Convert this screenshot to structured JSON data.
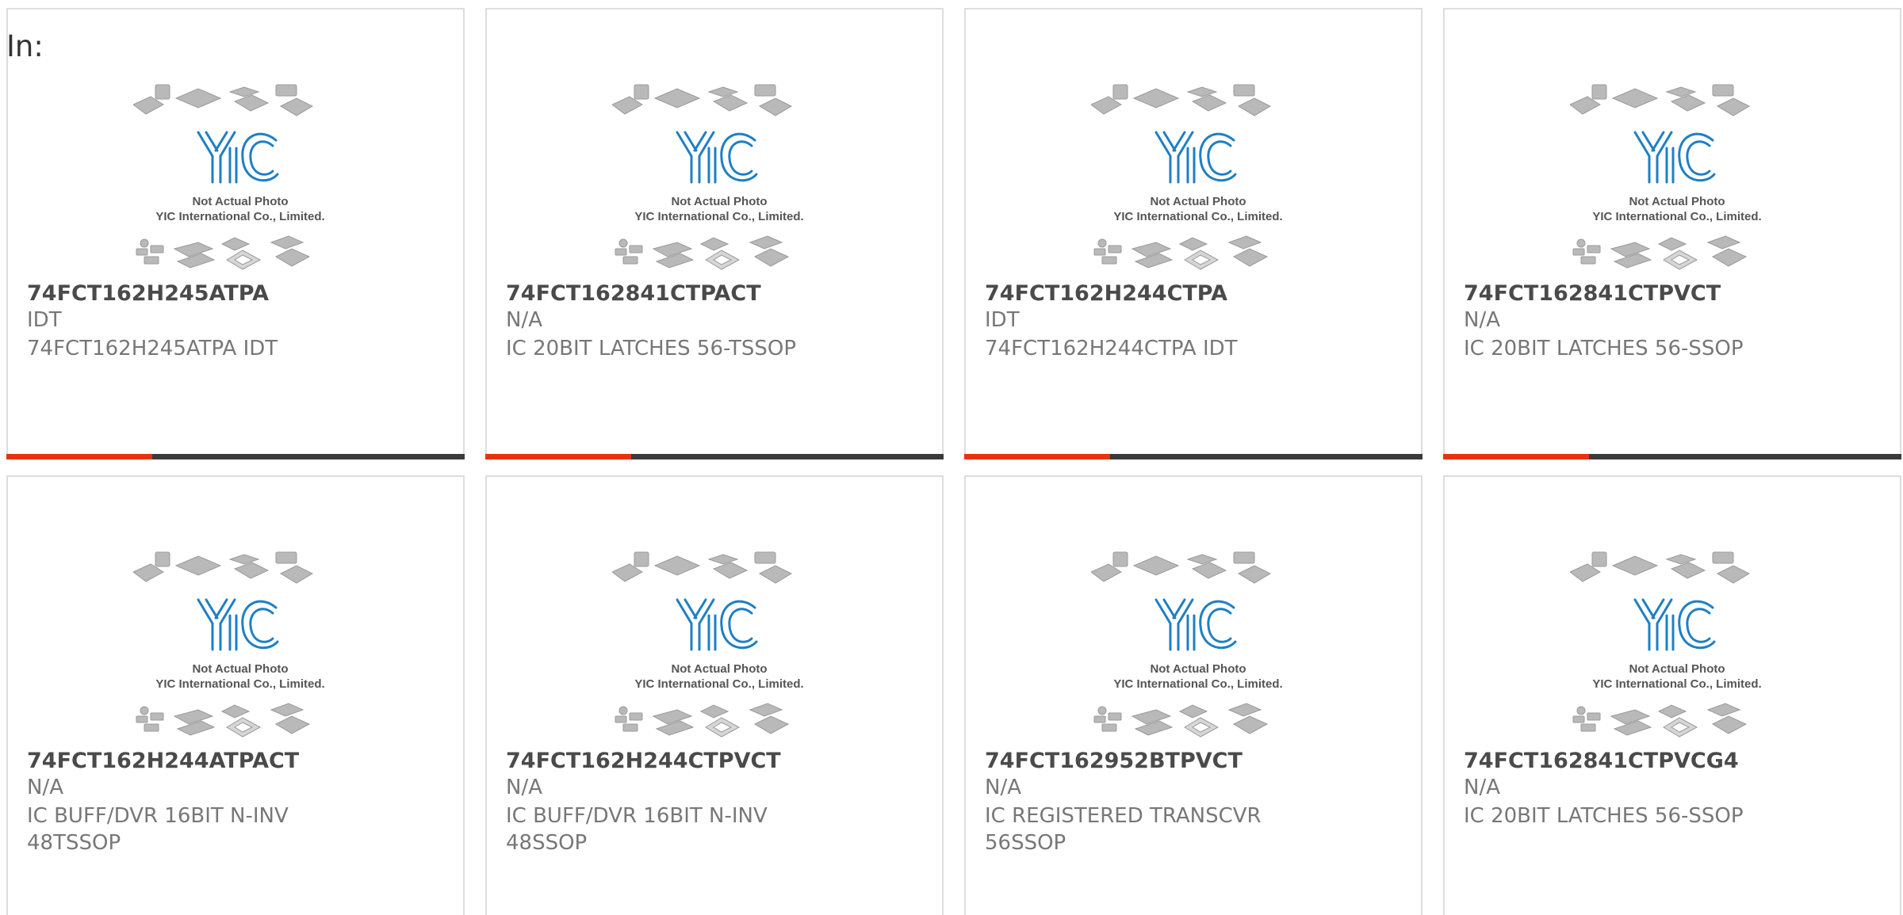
{
  "heading": "In:",
  "photo": {
    "brand": "YIC",
    "caption_line1": "Not Actual Photo",
    "caption_line2": "YIC International Co., Limited."
  },
  "colors": {
    "accent": "#e8330f",
    "bar": "#3a3a3a",
    "brand_blue": "#1e7fc4",
    "text": "#777777",
    "title": "#4a4a4a"
  },
  "products": [
    {
      "part": "74FCT162H245ATPA",
      "mfr": "IDT",
      "desc": "74FCT162H245ATPA IDT"
    },
    {
      "part": "74FCT162841CTPACT",
      "mfr": "N/A",
      "desc": "IC 20BIT LATCHES 56-TSSOP"
    },
    {
      "part": "74FCT162H244CTPA",
      "mfr": "IDT",
      "desc": "74FCT162H244CTPA IDT"
    },
    {
      "part": "74FCT162841CTPVCT",
      "mfr": "N/A",
      "desc": "IC 20BIT LATCHES 56-SSOP"
    },
    {
      "part": "74FCT162H244ATPACT",
      "mfr": "N/A",
      "desc": "IC BUFF/DVR 16BIT N-INV 48TSSOP"
    },
    {
      "part": "74FCT162H244CTPVCT",
      "mfr": "N/A",
      "desc": "IC BUFF/DVR 16BIT N-INV 48SSOP"
    },
    {
      "part": "74FCT162952BTPVCT",
      "mfr": "N/A",
      "desc": "IC REGISTERED TRANSCVR 56SSOP"
    },
    {
      "part": "74FCT162841CTPVCG4",
      "mfr": "N/A",
      "desc": "IC 20BIT LATCHES 56-SSOP"
    }
  ]
}
